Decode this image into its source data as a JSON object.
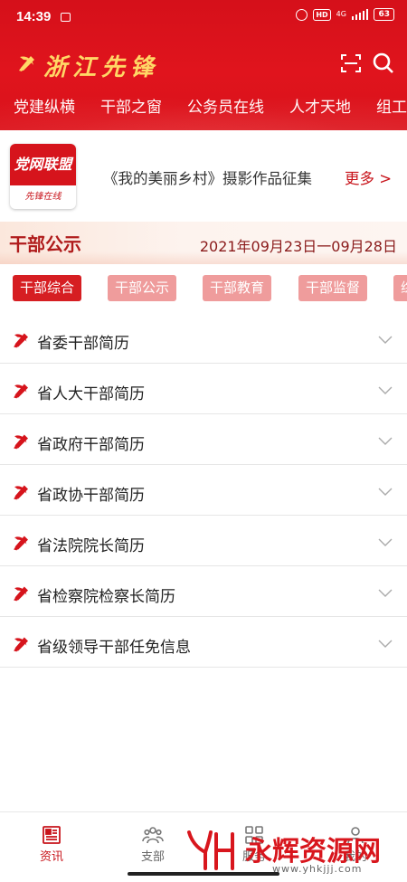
{
  "status_bar": {
    "time": "14:39",
    "network": "4G",
    "hd": "HD",
    "battery": "63"
  },
  "app": {
    "title": "浙江先锋"
  },
  "nav_tabs": [
    "党建纵横",
    "干部之窗",
    "公务员在线",
    "人才天地",
    "组工"
  ],
  "notice": {
    "logo_top": "党网联盟",
    "logo_bottom": "先锋在线",
    "text": "《我的美丽乡村》摄影作品征集",
    "more": "更多 >"
  },
  "section": {
    "title": "干部公示",
    "date_range": "2021年09月23日一09月28日"
  },
  "categories": [
    {
      "label": "干部综合",
      "active": true
    },
    {
      "label": "干部公示",
      "active": false
    },
    {
      "label": "干部教育",
      "active": false
    },
    {
      "label": "干部监督",
      "active": false
    },
    {
      "label": "综",
      "active": false
    }
  ],
  "list_items": [
    "省委干部简历",
    "省人大干部简历",
    "省政府干部简历",
    "省政协干部简历",
    "省法院院长简历",
    "省检察院检察长简历",
    "省级领导干部任免信息"
  ],
  "bottom_tabs": [
    {
      "label": "资讯",
      "icon": "newspaper-icon",
      "active": true
    },
    {
      "label": "支部",
      "icon": "group-icon",
      "active": false
    },
    {
      "label": "服务",
      "icon": "grid-icon",
      "active": false
    },
    {
      "label": "我的",
      "icon": "user-icon",
      "active": false
    }
  ],
  "watermark": {
    "text": "永辉资源网",
    "url": "www.yhkjjj.com"
  },
  "colors": {
    "primary": "#d6141c",
    "chip_inactive": "#ef9c9c",
    "gold": "#ffd766"
  }
}
